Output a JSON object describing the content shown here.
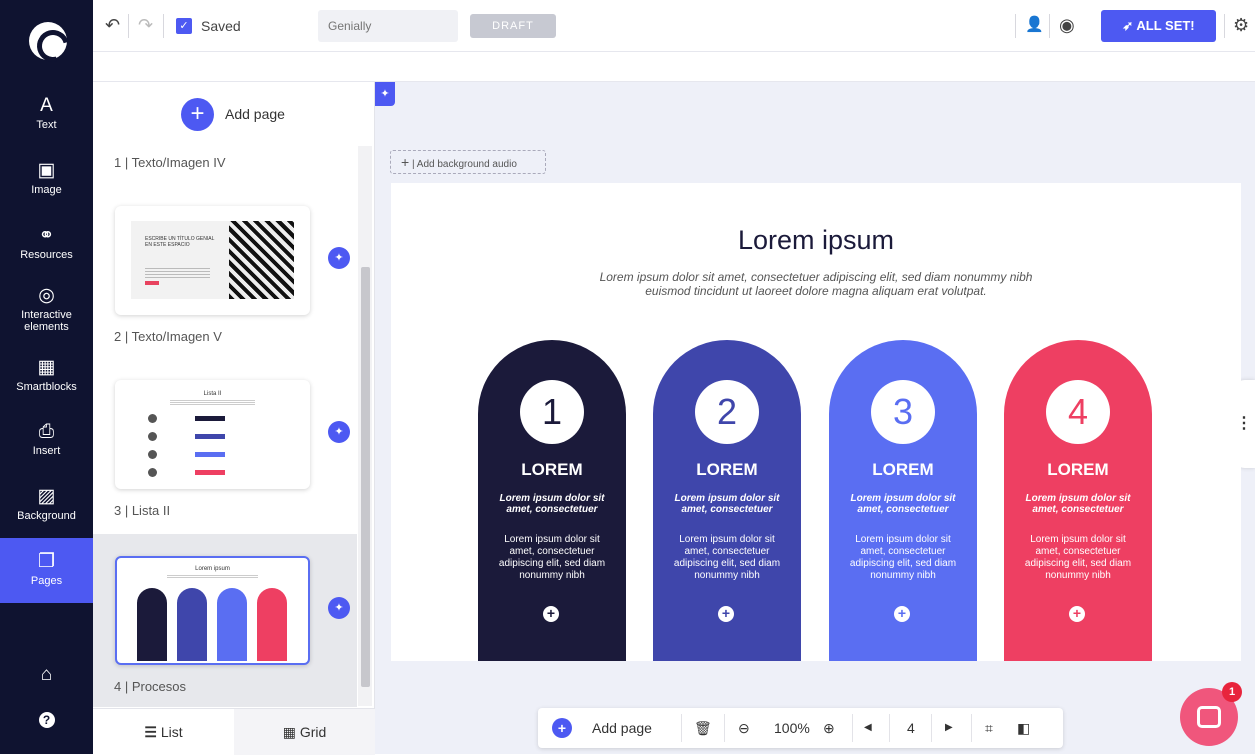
{
  "app": {
    "name": "Genially"
  },
  "sidebar": {
    "items": [
      {
        "label": "Text",
        "icon": "A"
      },
      {
        "label": "Image",
        "icon": "▣"
      },
      {
        "label": "Resources",
        "icon": "⚭"
      },
      {
        "label": "Interactive elements",
        "icon": "◎"
      },
      {
        "label": "Smartblocks",
        "icon": "▦"
      },
      {
        "label": "Insert",
        "icon": "⎙"
      },
      {
        "label": "Background",
        "icon": "▨"
      },
      {
        "label": "Pages",
        "icon": "❐"
      }
    ],
    "bottom_icons": [
      "briefcase-icon",
      "help-icon"
    ]
  },
  "toolbar": {
    "saved_label": "Saved",
    "title_placeholder": "Genially",
    "draft_label": "DRAFT",
    "allset_label": "ALL SET!"
  },
  "panel": {
    "add_page_label": "Add page",
    "pages": [
      {
        "label": "1 | Texto/Imagen IV"
      },
      {
        "label": "2 | Texto/Imagen V"
      },
      {
        "label": "3 | Lista II"
      },
      {
        "label": "4 | Procesos"
      }
    ],
    "thumb1": {
      "title": "ESCRIBE UN TÍTULO GENIAL EN ESTE ESPACIO"
    },
    "thumb2": {
      "title": "Lista II"
    },
    "thumb3": {
      "title": "Lorem ipsum"
    },
    "tabs": {
      "list": "List",
      "grid": "Grid"
    }
  },
  "canvas": {
    "add_audio_label": "Add background audio"
  },
  "slide": {
    "title": "Lorem ipsum",
    "subtitle": "Lorem ipsum dolor sit amet, consectetuer adipiscing elit, sed diam nonummy nibh euismod tincidunt ut laoreet dolore magna aliquam erat volutpat.",
    "pillars": [
      {
        "num": "1",
        "title": "LOREM",
        "sub": "Lorem ipsum dolor sit amet, consectetuer",
        "body": "Lorem ipsum dolor sit amet, consectetuer adipiscing elit, sed diam nonummy nibh",
        "color": "#1b1a3a"
      },
      {
        "num": "2",
        "title": "LOREM",
        "sub": "Lorem ipsum dolor sit amet, consectetuer",
        "body": "Lorem ipsum dolor sit amet, consectetuer adipiscing elit, sed diam nonummy nibh",
        "color": "#3f46ab"
      },
      {
        "num": "3",
        "title": "LOREM",
        "sub": "Lorem ipsum dolor sit amet, consectetuer",
        "body": "Lorem ipsum dolor sit amet, consectetuer adipiscing elit, sed diam nonummy nibh",
        "color": "#5a6ef2"
      },
      {
        "num": "4",
        "title": "LOREM",
        "sub": "Lorem ipsum dolor sit amet, consectetuer",
        "body": "Lorem ipsum dolor sit amet, consectetuer adipiscing elit, sed diam nonummy nibh",
        "color": "#ee3f62"
      }
    ]
  },
  "bottombar": {
    "add_page_label": "Add page",
    "zoom": "100%",
    "page_number": "4"
  },
  "chat": {
    "badge": "1"
  },
  "colors": {
    "accent": "#4d59f2",
    "sidebar": "#0f1330"
  }
}
